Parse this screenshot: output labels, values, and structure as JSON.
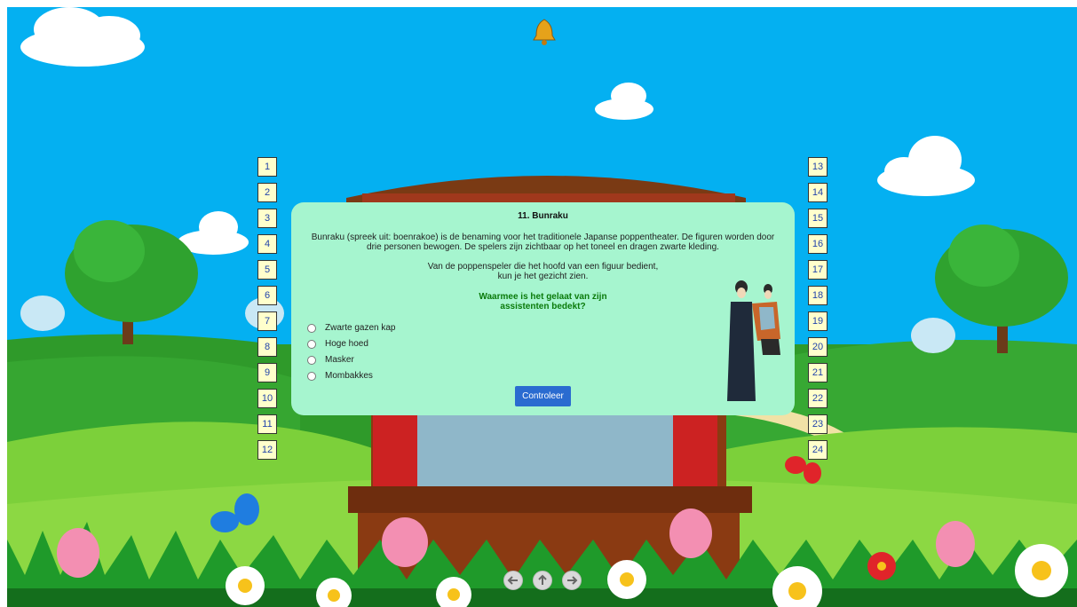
{
  "quiz": {
    "title": "11. Bunraku",
    "intro": "Bunraku (spreek uit: boenrakoe) is de benaming voor het traditionele Japanse poppentheater. De figuren worden door drie personen bewogen. De spelers zijn zichtbaar op het toneel en dragen zwarte kleding.",
    "text_line1": "Van de poppenspeler die het hoofd van een figuur bedient,",
    "text_line2": "kun je het gezicht zien.",
    "question_line1": "Waarmee is het gelaat van zijn",
    "question_line2": "assistenten bedekt?",
    "options": [
      "Zwarte gazen kap",
      "Hoge hoed",
      "Masker",
      "Mombakkes"
    ],
    "check_label": "Controleer"
  },
  "left_numbers": [
    "1",
    "2",
    "3",
    "4",
    "5",
    "6",
    "7",
    "8",
    "9",
    "10",
    "11",
    "12"
  ],
  "right_numbers": [
    "13",
    "14",
    "15",
    "16",
    "17",
    "18",
    "19",
    "20",
    "21",
    "22",
    "23",
    "24"
  ],
  "icons": {
    "bell": "bell-icon",
    "nav_back": "arrow-left-icon",
    "nav_up": "arrow-up-icon",
    "nav_forward": "arrow-right-icon"
  },
  "colors": {
    "sky": "#04b0f1",
    "panel": "#a6f5cf",
    "button": "#2a6bd0",
    "question_text": "#0a7a0a",
    "number_box": "#ffffcc"
  }
}
